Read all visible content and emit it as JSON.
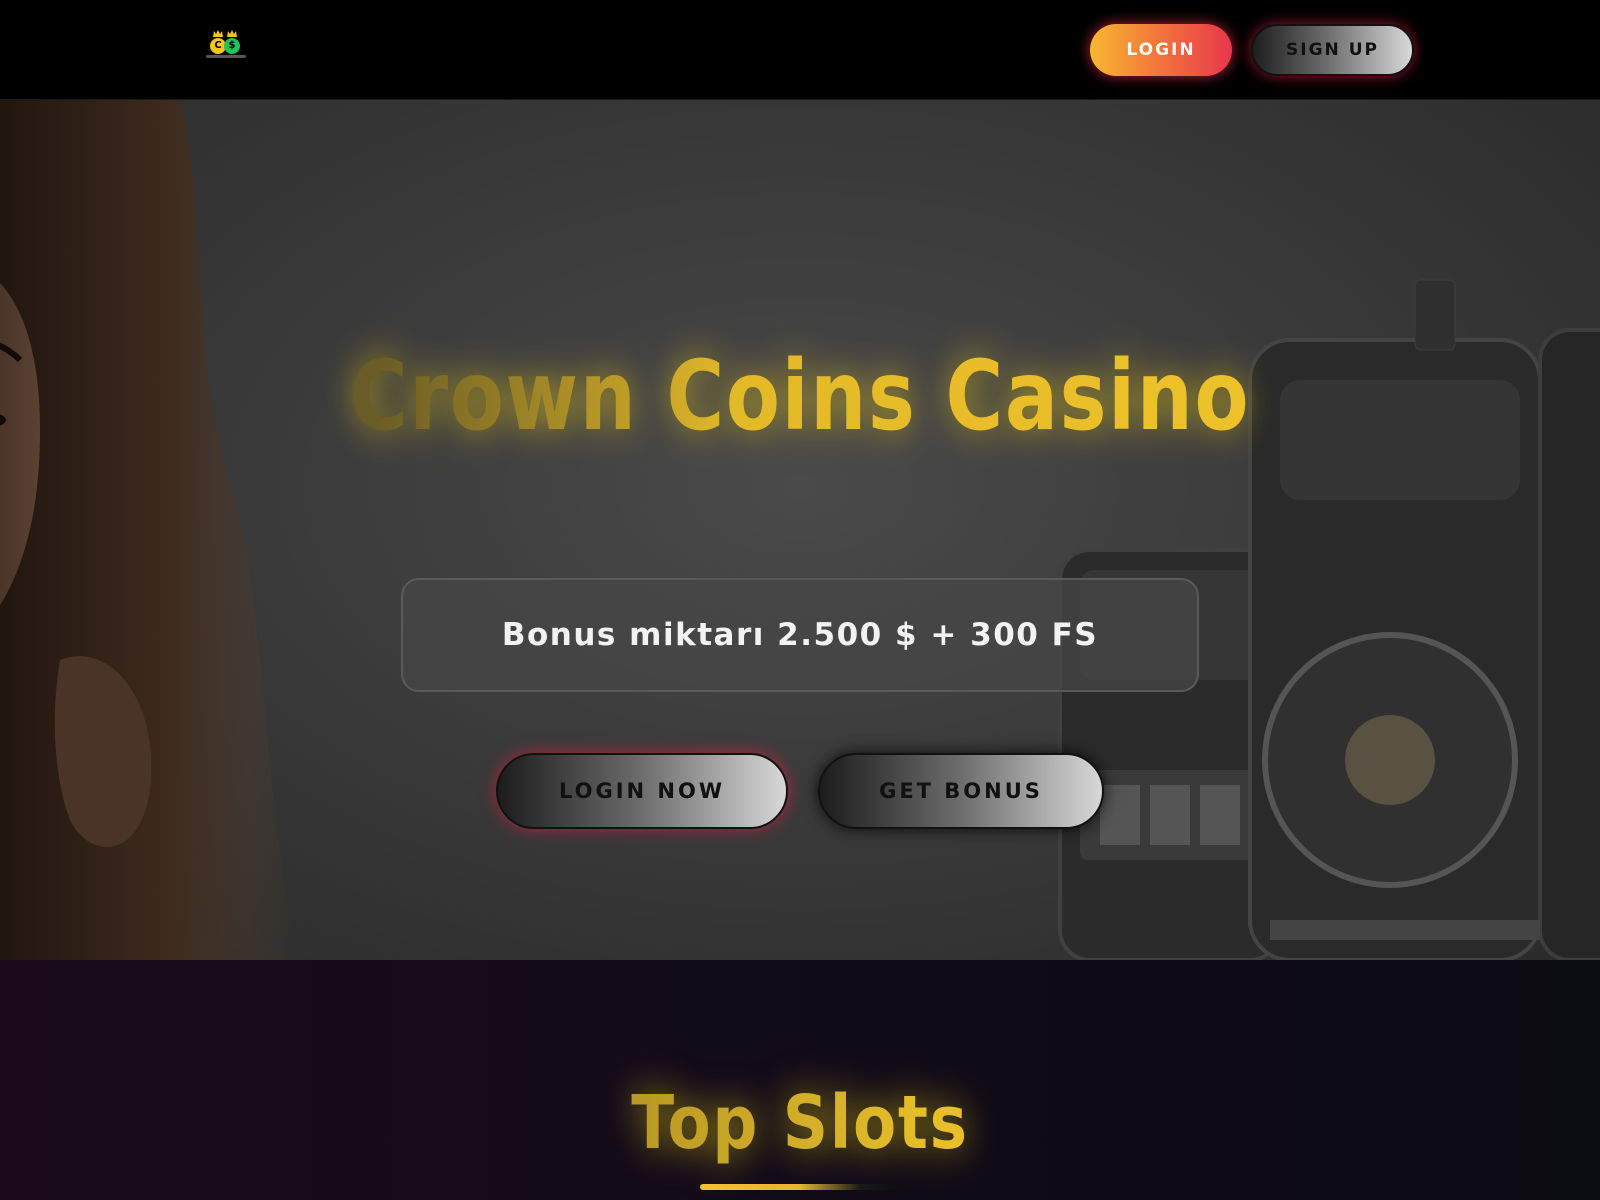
{
  "header": {
    "logo_alt": "Crown Coins Casino logo",
    "login_label": "LOGIN",
    "signup_label": "SIGN UP"
  },
  "hero": {
    "title": "Crown Coins Casino",
    "bonus_text": "Bonus miktarı 2.500 $ + 300 FS",
    "login_now_label": "LOGIN NOW",
    "get_bonus_label": "GET BONUS"
  },
  "slots_section": {
    "title": "Top Slots"
  },
  "colors": {
    "accent_gold": "#f2c52a",
    "login_gradient_start": "#f7b731",
    "login_gradient_end": "#e8374b",
    "background": "#000000"
  }
}
